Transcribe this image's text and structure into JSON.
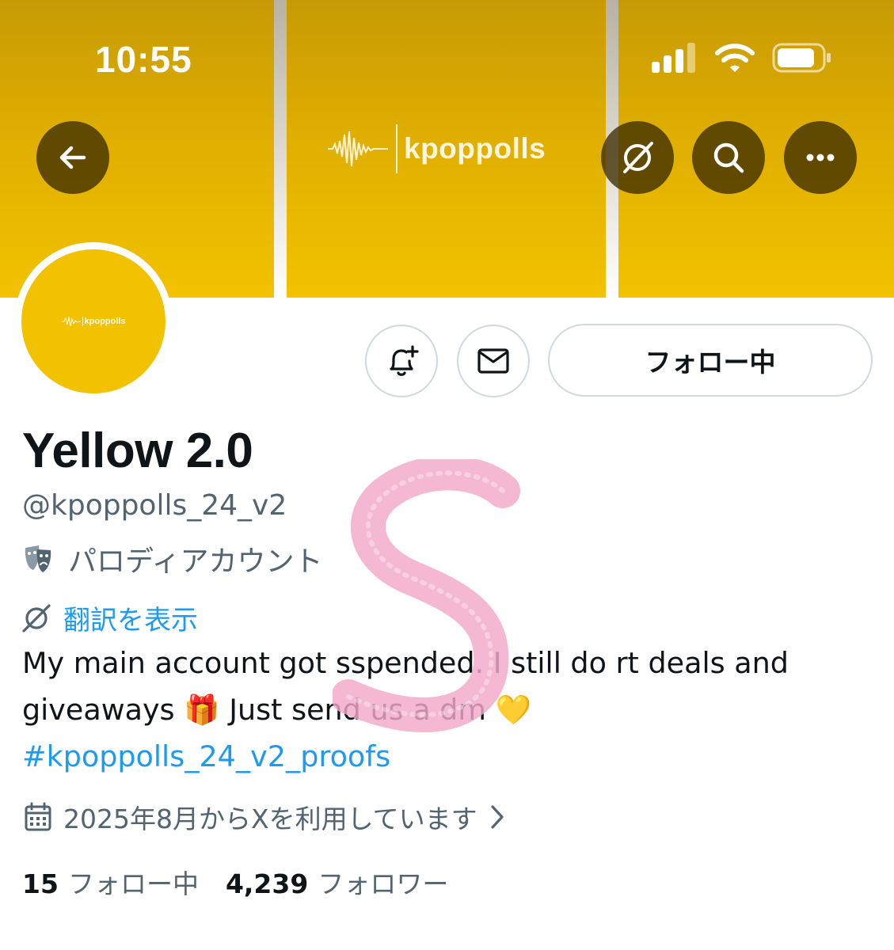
{
  "status_bar": {
    "time": "10:55"
  },
  "banner": {
    "logo_text": "kpoppolls",
    "background_color": "#f3c200"
  },
  "header_buttons": {
    "back_icon": "arrow-left-icon",
    "translate_icon": "globe-slash-icon",
    "search_icon": "search-icon",
    "more_icon": "more-horizontal-icon"
  },
  "avatar": {
    "logo_text": "kpoppolls"
  },
  "actions": {
    "notify_icon": "bell-plus-icon",
    "message_icon": "envelope-icon",
    "follow_label": "フォロー中"
  },
  "profile": {
    "name": "Yellow 2.0",
    "handle": "@kpoppolls_24_v2",
    "parody_label": "パロディアカウント",
    "translate_label": "翻訳を表示",
    "bio_line1": "My main account got sspended. I still do rt deals and",
    "bio_line2_a": "giveaways",
    "bio_emoji_gift": "🎁",
    "bio_line2_b": "Just send us a dm",
    "bio_emoji_heart": "💛",
    "bio_hashtag": "#kpoppolls_24_v2_proofs",
    "joined": "2025年8月からXを利用しています",
    "following_count": "15",
    "following_label": "フォロー中",
    "followers_count": "4,239",
    "followers_label": "フォロワー"
  },
  "colors": {
    "accent": "#1d9bf0",
    "secondary_text": "#536471",
    "primary_text": "#0f1419",
    "scribble": "#f2a8c8"
  }
}
